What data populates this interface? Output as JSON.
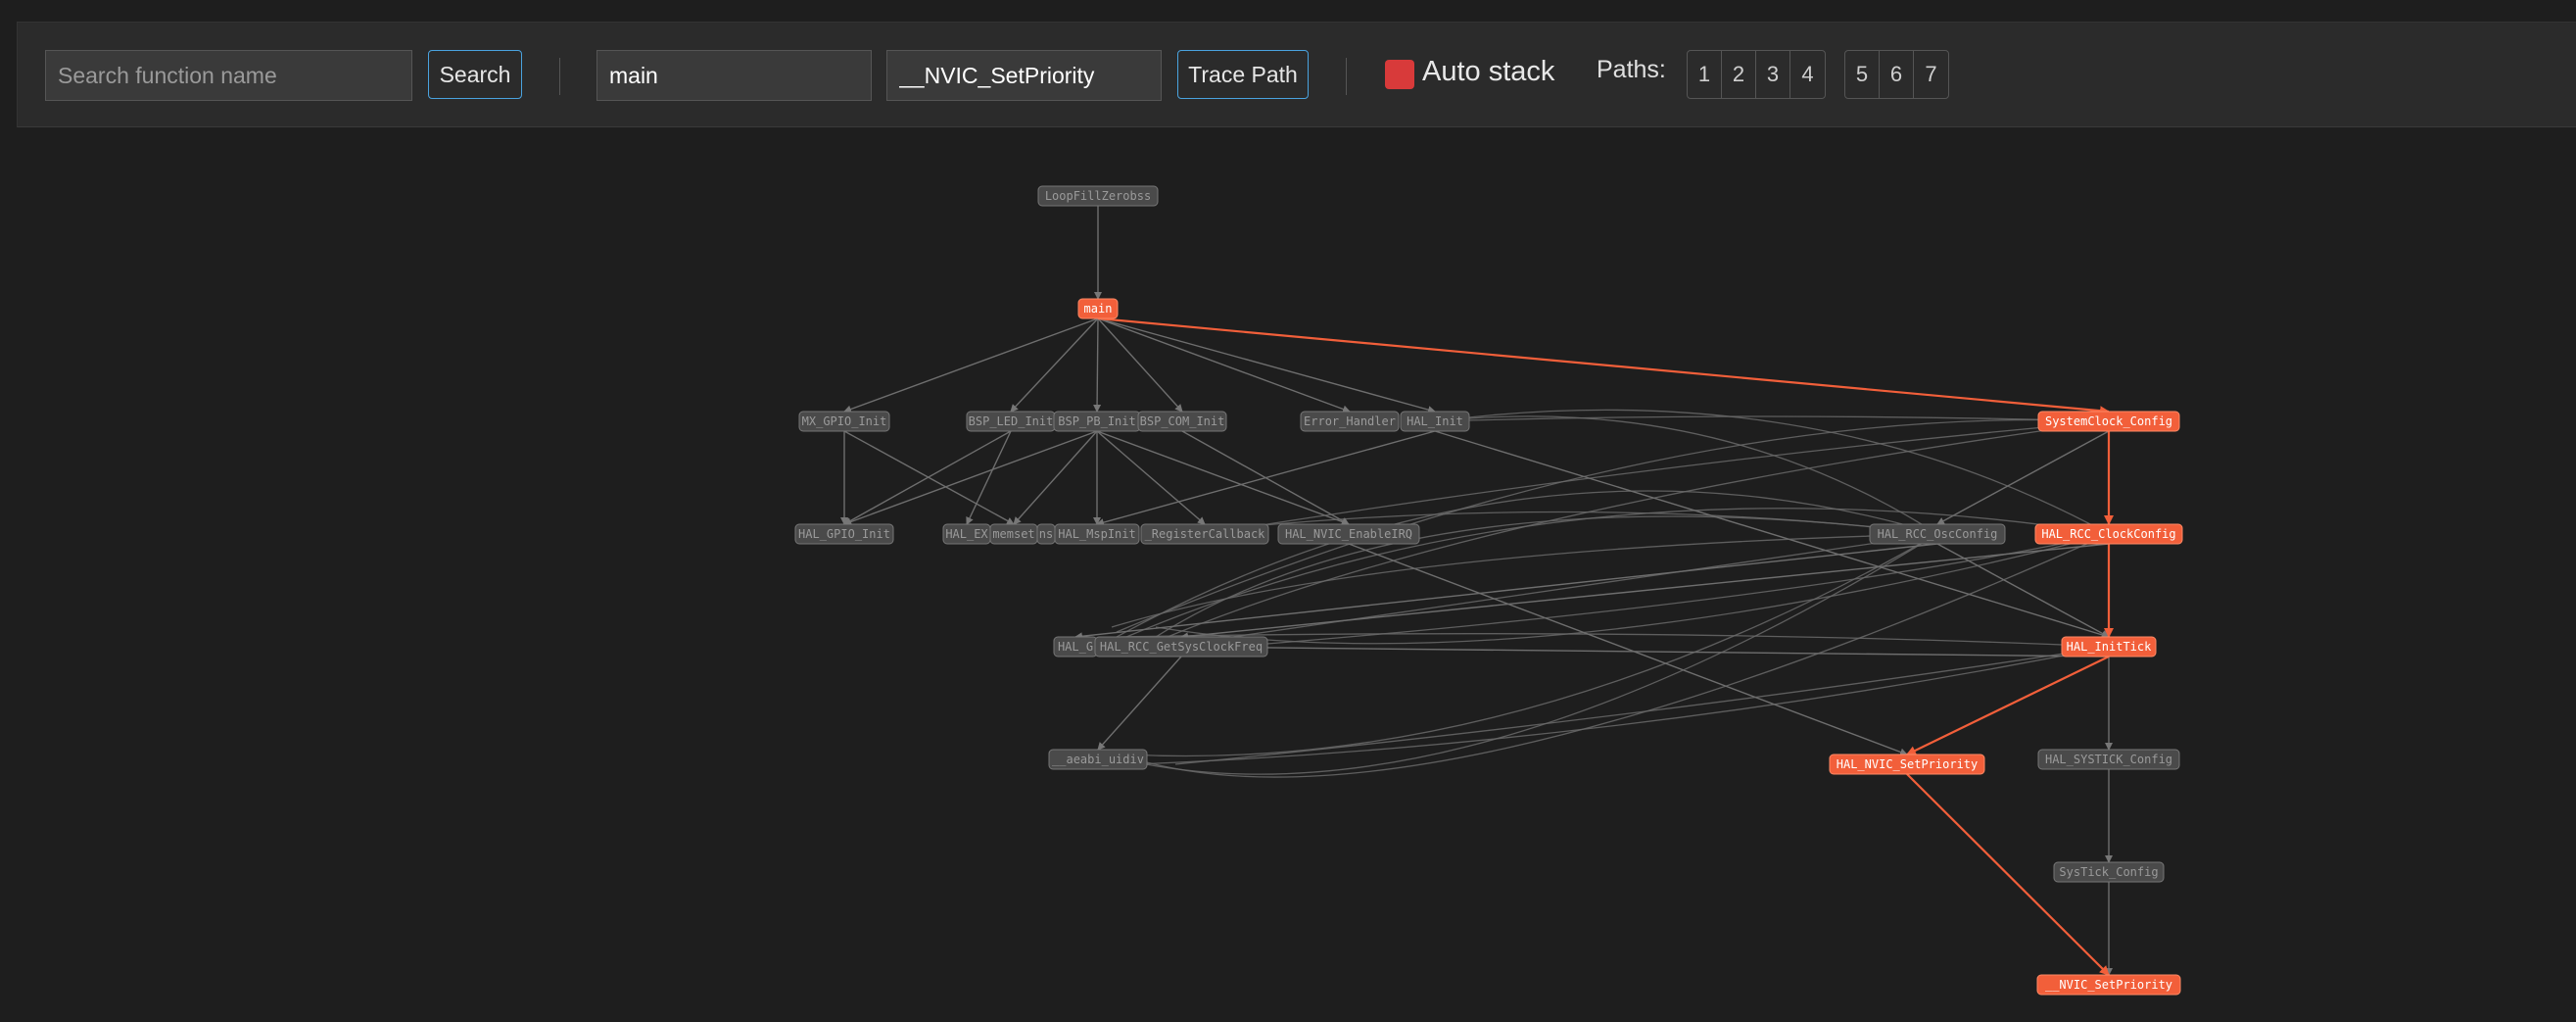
{
  "toolbar": {
    "search_placeholder": "Search function name",
    "search_button": "Search",
    "from_value": "main",
    "to_value": "__NVIC_SetPriority",
    "trace_button": "Trace Path",
    "auto_stack_label": "Auto stack",
    "paths_label": "Paths:",
    "paths_group1": [
      "1",
      "2",
      "3",
      "4"
    ],
    "paths_group2": [
      "5",
      "6",
      "7"
    ]
  },
  "colors": {
    "highlight": "#f25f3a",
    "node_fill": "#4a4a4a",
    "edge": "#6e6e6e",
    "background": "#1e1e1e"
  },
  "graph": {
    "nodes": [
      {
        "id": "LoopFillZerobss",
        "label": "LoopFillZerobss",
        "highlight": false
      },
      {
        "id": "main",
        "label": "main",
        "highlight": true
      },
      {
        "id": "MX_GPIO_Init",
        "label": "MX_GPIO_Init",
        "highlight": false
      },
      {
        "id": "BSP_LED_Init",
        "label": "BSP_LED_Init",
        "highlight": false
      },
      {
        "id": "BSP_PB_Init",
        "label": "BSP_PB_Init",
        "highlight": false
      },
      {
        "id": "BSP_COM_Init",
        "label": "BSP_COM_Init",
        "highlight": false
      },
      {
        "id": "Error_Handler",
        "label": "Error_Handler",
        "highlight": false
      },
      {
        "id": "HAL_Init",
        "label": "HAL_Init",
        "highlight": false
      },
      {
        "id": "SystemClock_Config",
        "label": "SystemClock_Config",
        "highlight": true
      },
      {
        "id": "HAL_GPIO_Init",
        "label": "HAL_GPIO_Init",
        "highlight": false
      },
      {
        "id": "HAL_EXTI",
        "label": "HAL_EX",
        "highlight": false
      },
      {
        "id": "memset",
        "label": "memset",
        "highlight": false
      },
      {
        "id": "hidden_a",
        "label": "ns",
        "highlight": false
      },
      {
        "id": "HAL_MspInit",
        "label": "HAL_MspInit",
        "highlight": false
      },
      {
        "id": "RegisterCallback",
        "label": "_RegisterCallback",
        "highlight": false
      },
      {
        "id": "HAL_NVIC_EnableIRQ",
        "label": "HAL_NVIC_EnableIRQ",
        "highlight": false
      },
      {
        "id": "HAL_RCC_OscConfig",
        "label": "HAL_RCC_OscConfig",
        "highlight": false
      },
      {
        "id": "HAL_RCC_ClockConfig",
        "label": "HAL_RCC_ClockConfig",
        "highlight": true
      },
      {
        "id": "HAL_G",
        "label": "HAL_G",
        "highlight": false
      },
      {
        "id": "HAL_RCC_GetSysClockFreq",
        "label": "HAL_RCC_GetSysClockFreq",
        "highlight": false
      },
      {
        "id": "HAL_InitTick",
        "label": "HAL_InitTick",
        "highlight": true
      },
      {
        "id": "aeabi_uidiv",
        "label": "__aeabi_uidiv",
        "highlight": false
      },
      {
        "id": "HAL_NVIC_SetPriority",
        "label": "HAL_NVIC_SetPriority",
        "highlight": true
      },
      {
        "id": "HAL_SYSTICK_Config",
        "label": "HAL_SYSTICK_Config",
        "highlight": false
      },
      {
        "id": "SysTick_Config",
        "label": "SysTick_Config",
        "highlight": false
      },
      {
        "id": "NVIC_SetPriority",
        "label": "__NVIC_SetPriority",
        "highlight": true
      }
    ],
    "edges": [
      {
        "from": "LoopFillZerobss",
        "to": "main",
        "highlight": false
      },
      {
        "from": "main",
        "to": "MX_GPIO_Init",
        "highlight": false
      },
      {
        "from": "main",
        "to": "BSP_LED_Init",
        "highlight": false
      },
      {
        "from": "main",
        "to": "BSP_PB_Init",
        "highlight": false
      },
      {
        "from": "main",
        "to": "BSP_COM_Init",
        "highlight": false
      },
      {
        "from": "main",
        "to": "Error_Handler",
        "highlight": false
      },
      {
        "from": "main",
        "to": "HAL_Init",
        "highlight": false
      },
      {
        "from": "main",
        "to": "SystemClock_Config",
        "highlight": true
      },
      {
        "from": "MX_GPIO_Init",
        "to": "HAL_GPIO_Init",
        "highlight": false
      },
      {
        "from": "MX_GPIO_Init",
        "to": "memset",
        "highlight": false
      },
      {
        "from": "BSP_LED_Init",
        "to": "HAL_GPIO_Init",
        "highlight": false
      },
      {
        "from": "BSP_LED_Init",
        "to": "HAL_EXTI",
        "highlight": false
      },
      {
        "from": "BSP_PB_Init",
        "to": "HAL_GPIO_Init",
        "highlight": false
      },
      {
        "from": "BSP_PB_Init",
        "to": "memset",
        "highlight": false
      },
      {
        "from": "BSP_PB_Init",
        "to": "HAL_NVIC_EnableIRQ",
        "highlight": false
      },
      {
        "from": "BSP_PB_Init",
        "to": "RegisterCallback",
        "highlight": false
      },
      {
        "from": "BSP_PB_Init",
        "to": "HAL_MspInit",
        "highlight": false
      },
      {
        "from": "BSP_COM_Init",
        "to": "HAL_NVIC_EnableIRQ",
        "highlight": false
      },
      {
        "from": "HAL_Init",
        "to": "HAL_MspInit",
        "highlight": false
      },
      {
        "from": "HAL_Init",
        "to": "HAL_InitTick",
        "highlight": false
      },
      {
        "from": "SystemClock_Config",
        "to": "HAL_RCC_OscConfig",
        "highlight": false
      },
      {
        "from": "SystemClock_Config",
        "to": "HAL_RCC_ClockConfig",
        "highlight": true
      },
      {
        "from": "HAL_RCC_ClockConfig",
        "to": "HAL_InitTick",
        "highlight": true
      },
      {
        "from": "HAL_RCC_ClockConfig",
        "to": "HAL_RCC_GetSysClockFreq",
        "highlight": false
      },
      {
        "from": "HAL_RCC_OscConfig",
        "to": "HAL_InitTick",
        "highlight": false
      },
      {
        "from": "HAL_RCC_OscConfig",
        "to": "HAL_G",
        "highlight": false
      },
      {
        "from": "HAL_InitTick",
        "to": "HAL_NVIC_SetPriority",
        "highlight": true
      },
      {
        "from": "HAL_InitTick",
        "to": "HAL_SYSTICK_Config",
        "highlight": false
      },
      {
        "from": "HAL_InitTick",
        "to": "HAL_RCC_GetSysClockFreq",
        "highlight": false
      },
      {
        "from": "HAL_RCC_GetSysClockFreq",
        "to": "aeabi_uidiv",
        "highlight": false
      },
      {
        "from": "HAL_NVIC_EnableIRQ",
        "to": "HAL_NVIC_SetPriority",
        "highlight": false
      },
      {
        "from": "HAL_NVIC_SetPriority",
        "to": "NVIC_SetPriority",
        "highlight": true
      },
      {
        "from": "HAL_SYSTICK_Config",
        "to": "SysTick_Config",
        "highlight": false
      },
      {
        "from": "SysTick_Config",
        "to": "NVIC_SetPriority",
        "highlight": false
      }
    ]
  }
}
